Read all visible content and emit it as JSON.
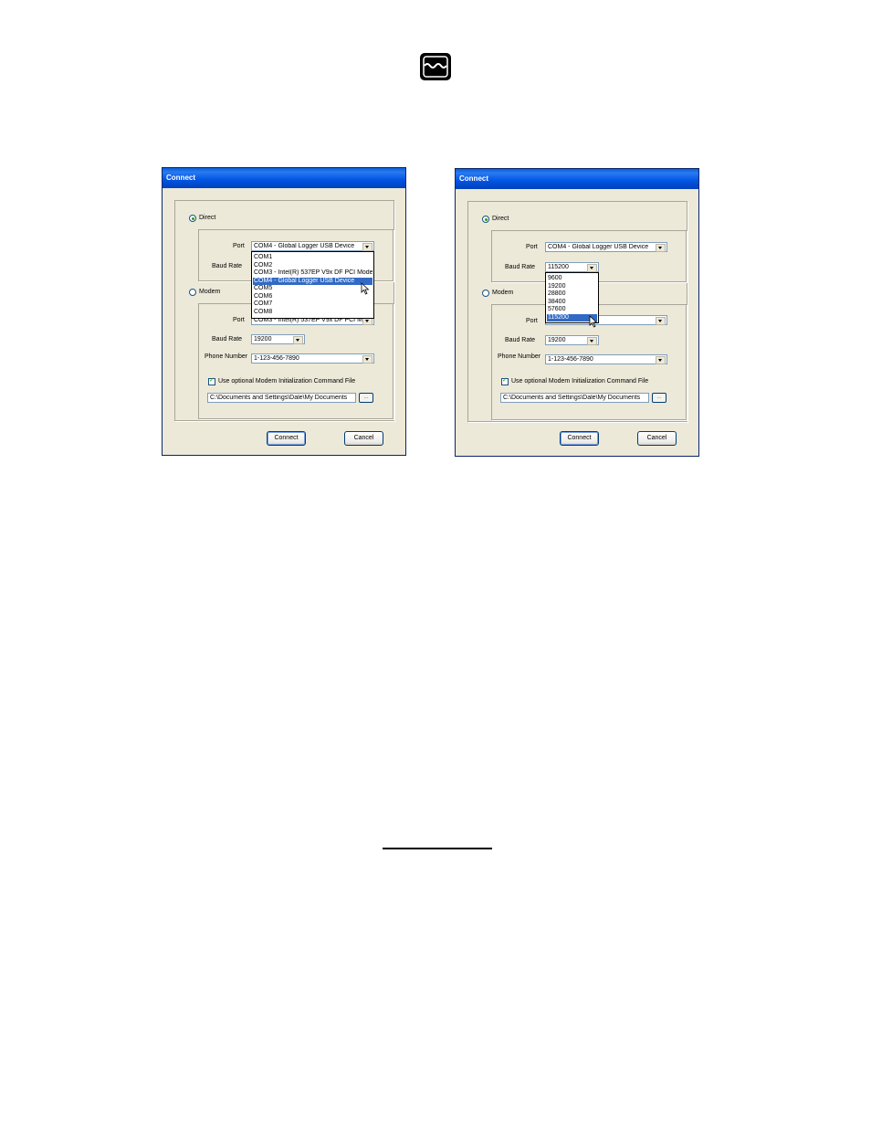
{
  "dialogs": [
    {
      "title": "Connect",
      "direct_label": "Direct",
      "direct_selected": true,
      "direct_port_label": "Port",
      "direct_port_value": "COM4 - Global Logger USB Device",
      "direct_baud_label": "Baud Rate",
      "direct_baud_value": "",
      "modem_label": "Modem",
      "modem_selected": false,
      "modem_port_label": "Port",
      "modem_port_value": "COM3 - Intel(R) 537EP V9x DF PCI M",
      "modem_baud_label": "Baud Rate",
      "modem_baud_value": "19200",
      "phone_label": "Phone Number",
      "phone_value": "1-123-456-7890",
      "init_checkbox_label": "Use optional Modem Initialization Command File",
      "init_checked": true,
      "path_value": "C:\\Documents and Settings\\Dale\\My Documents",
      "browse_label": "...",
      "connect_label": "Connect",
      "cancel_label": "Cancel",
      "open_dropdown": {
        "items": [
          "COM1",
          "COM2",
          "COM3 - Intel(R) 537EP V9x DF PCI Mode",
          "COM4 - Global Logger USB Device",
          "COM5",
          "COM6",
          "COM7",
          "COM8"
        ],
        "selected_index": 3
      }
    },
    {
      "title": "Connect",
      "direct_label": "Direct",
      "direct_selected": true,
      "direct_port_label": "Port",
      "direct_port_value": "COM4 - Global Logger USB Device",
      "direct_baud_label": "Baud Rate",
      "direct_baud_value": "115200",
      "modem_label": "Modem",
      "modem_selected": false,
      "modem_port_label": "Port",
      "modem_port_value": "COM7",
      "modem_baud_label": "Baud Rate",
      "modem_baud_value": "19200",
      "phone_label": "Phone Number",
      "phone_value": "1-123-456-7890",
      "init_checkbox_label": "Use optional Modem Initialization Command File",
      "init_checked": true,
      "path_value": "C:\\Documents and Settings\\Dale\\My Documents",
      "browse_label": "...",
      "connect_label": "Connect",
      "cancel_label": "Cancel",
      "open_dropdown": {
        "items": [
          "9600",
          "19200",
          "28800",
          "38400",
          "57600",
          "115200"
        ],
        "selected_index": 5
      }
    }
  ]
}
